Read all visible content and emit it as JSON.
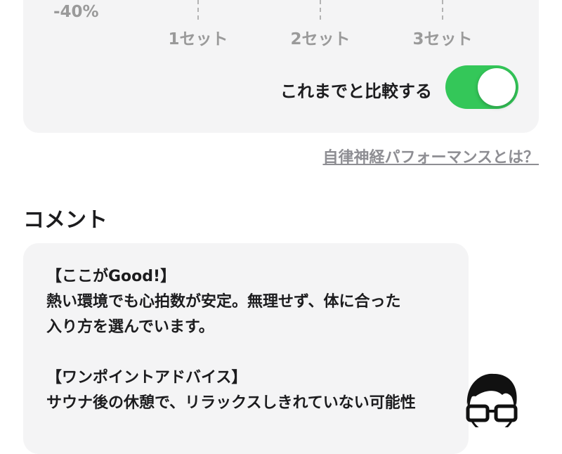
{
  "chart": {
    "y_tick_bottom": "-40%",
    "x_ticks": [
      "1セット",
      "2セット",
      "3セット"
    ]
  },
  "compare_toggle": {
    "label": "これまでと比較する",
    "state": "on",
    "color": "#34c759"
  },
  "info_link": "自律神経パフォーマンスとは？",
  "comment_section": {
    "title": "コメント",
    "paragraphs": [
      {
        "heading": "【ここがGood!】",
        "lines": [
          "熱い環境でも心拍数が安定。無理せず、体に合った",
          "入り方を選んでいます。"
        ]
      },
      {
        "heading": "【ワンポイントアドバイス】",
        "lines": [
          "サウナ後の休憩で、リラックスしきれていない可能性"
        ]
      }
    ]
  },
  "avatar": {
    "icon": "advisor-avatar-icon"
  }
}
